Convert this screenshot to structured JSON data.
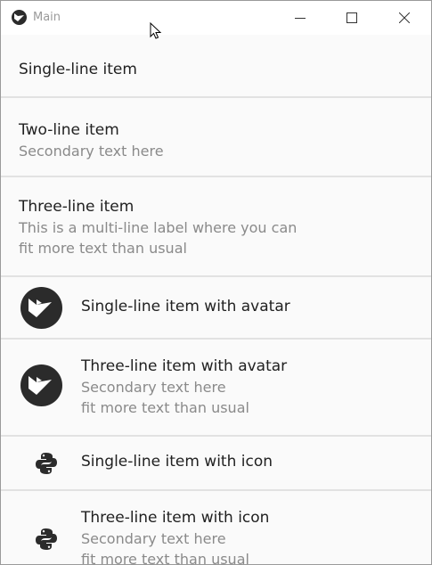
{
  "window": {
    "title": "Main",
    "app_icon": "kivy-logo-icon",
    "controls": [
      "minimize-icon",
      "maximize-icon",
      "close-icon"
    ]
  },
  "items": [
    {
      "primary": "Single-line item"
    },
    {
      "primary": "Two-line item",
      "secondary": "Secondary text here"
    },
    {
      "primary": "Three-line item",
      "secondary": "This is a multi-line label where you can",
      "tertiary": "fit more text than usual"
    },
    {
      "primary": "Single-line item with avatar",
      "leading": "kivy-avatar-icon"
    },
    {
      "primary": "Three-line item with avatar",
      "secondary": "Secondary text here",
      "tertiary": "fit more text than usual",
      "leading": "kivy-avatar-icon"
    },
    {
      "primary": "Single-line item with icon",
      "leading": "python-icon"
    },
    {
      "primary": "Three-line item with icon",
      "secondary": "Secondary text here",
      "tertiary": "fit more text than usual",
      "leading": "python-icon"
    }
  ],
  "colors": {
    "background": "#fafafa",
    "divider": "#e2e2e2",
    "primary_text": "#212121",
    "secondary_text": "#8a8a8a",
    "avatar": "#2b2b2b"
  }
}
